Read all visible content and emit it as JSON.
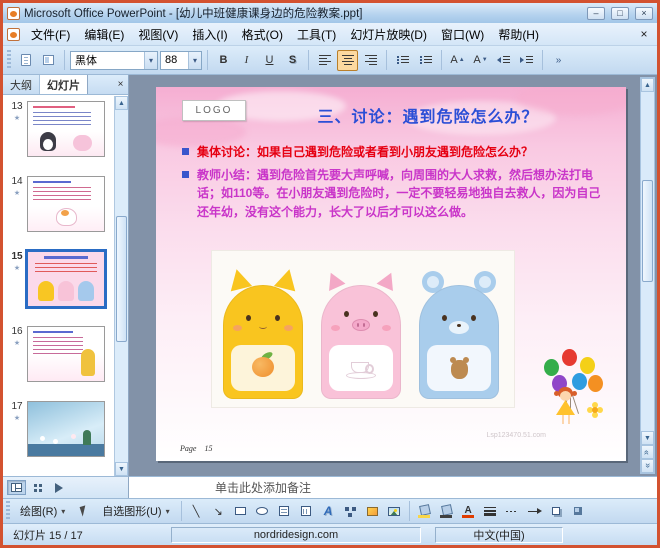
{
  "window": {
    "title": "Microsoft Office PowerPoint - [幼儿中班健康课身边的危险教案.ppt]",
    "minimize": "–",
    "maximize": "□",
    "close": "×"
  },
  "icons": {
    "dropdown": "▾",
    "menu_close": "×",
    "tab_close": "×",
    "scroll_up": "▲",
    "scroll_down": "▼",
    "chevron_double": "«",
    "anim_star": "★",
    "line_diag": "╲",
    "arrow_diag": "↘",
    "letter_a": "A",
    "small_up": "▲",
    "small_down": "▼",
    "overflow": "»"
  },
  "menu": {
    "items": [
      {
        "label": "文件(F)"
      },
      {
        "label": "编辑(E)"
      },
      {
        "label": "视图(V)"
      },
      {
        "label": "插入(I)"
      },
      {
        "label": "格式(O)"
      },
      {
        "label": "工具(T)"
      },
      {
        "label": "幻灯片放映(D)"
      },
      {
        "label": "窗口(W)"
      },
      {
        "label": "帮助(H)"
      }
    ]
  },
  "format_toolbar": {
    "font_name": "黑体",
    "font_size": "88",
    "bold": "B",
    "italic": "I",
    "underline": "U",
    "shadow": "S"
  },
  "panel": {
    "tab_outline": "大纲",
    "tab_slides": "幻灯片",
    "selected_slide": "15",
    "slides": [
      {
        "num": "13"
      },
      {
        "num": "14"
      },
      {
        "num": "15"
      },
      {
        "num": "16"
      },
      {
        "num": "17"
      }
    ]
  },
  "slide": {
    "logo": "LOGO",
    "title": "三、讨论：遇到危险怎么办？",
    "bullet1": {
      "label": "集体讨论：",
      "text": "如果自己遇到危险或者看到小朋友遇到危险怎么办？"
    },
    "bullet2": {
      "label": "教师小结：",
      "text": "遇到危险首先要大声呼喊，向周围的大人求救，然后想办法打电话；如110等。在小朋友遇到危险时，一定不要轻易地独自去救人，因为自己还年幼，没有这个能力，长大了以后才可以这么做。"
    },
    "page_label": "Page",
    "page_number": "15",
    "watermark": "Lsp123470.51.com"
  },
  "notes": {
    "placeholder": "单击此处添加备注"
  },
  "draw_toolbar": {
    "draw": "绘图(R)",
    "autoshapes": "自选图形(U)"
  },
  "status": {
    "slide_indicator": "幻灯片 15 / 17",
    "site": "nordridesign.com",
    "language": "中文(中国)"
  },
  "colors": {
    "window_frame": "#d35230",
    "selection_blue": "#2a6cc4",
    "slide_title_blue": "#2b4ed6",
    "bullet1_red": "#e60012",
    "bullet2_magenta": "#c935c9"
  }
}
